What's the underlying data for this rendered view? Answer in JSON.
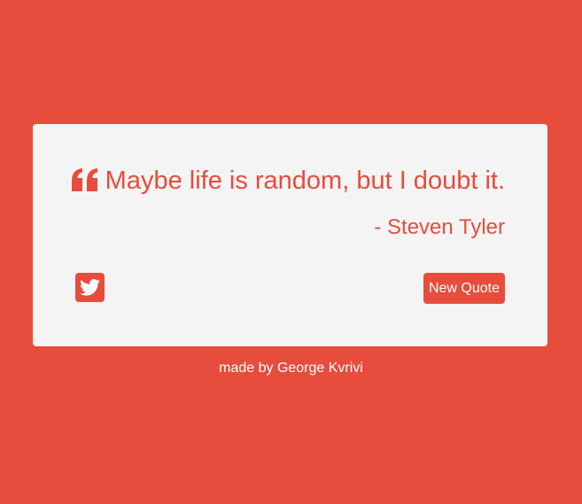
{
  "colors": {
    "background": "#E74C3C",
    "card": "#F4F4F4",
    "accent": "#E74C3C",
    "button_text": "#FFFFFF"
  },
  "quote": {
    "icon": "quote-left-icon",
    "text": "Maybe life is random, but I doubt it.",
    "author": "- Steven Tyler"
  },
  "actions": {
    "tweet_icon": "twitter-icon",
    "new_quote_label": "New Quote"
  },
  "footer": {
    "text": "made by George Kvrivi"
  }
}
